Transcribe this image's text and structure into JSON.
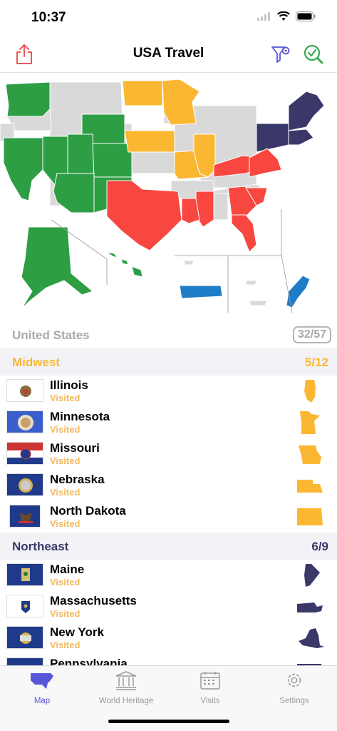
{
  "status_bar": {
    "time": "10:37"
  },
  "nav": {
    "title": "USA Travel"
  },
  "country": {
    "name": "United States",
    "count": "32/57"
  },
  "colors": {
    "midwest": "#fbb731",
    "northeast": "#3a3769",
    "south": "#f84740",
    "west": "#2e9e45",
    "territories": "#1f7cc7",
    "unvisited": "#d9d9d9",
    "visited_text": "#f5b85a",
    "accent": "#5856d6"
  },
  "sections": [
    {
      "name": "Midwest",
      "count": "5/12",
      "items": [
        {
          "name": "Illinois",
          "status": "Visited"
        },
        {
          "name": "Minnesota",
          "status": "Visited"
        },
        {
          "name": "Missouri",
          "status": "Visited"
        },
        {
          "name": "Nebraska",
          "status": "Visited"
        },
        {
          "name": "North Dakota",
          "status": "Visited"
        }
      ]
    },
    {
      "name": "Northeast",
      "count": "6/9",
      "items": [
        {
          "name": "Maine",
          "status": "Visited"
        },
        {
          "name": "Massachusetts",
          "status": "Visited"
        },
        {
          "name": "New York",
          "status": "Visited"
        },
        {
          "name": "Pennsylvania",
          "status": ""
        }
      ]
    }
  ],
  "tabs": [
    {
      "label": "Map",
      "icon": "us-map-icon"
    },
    {
      "label": "World Heritage",
      "icon": "temple-icon"
    },
    {
      "label": "Visits",
      "icon": "calendar-icon"
    },
    {
      "label": "Settings",
      "icon": "gear-icon"
    }
  ]
}
